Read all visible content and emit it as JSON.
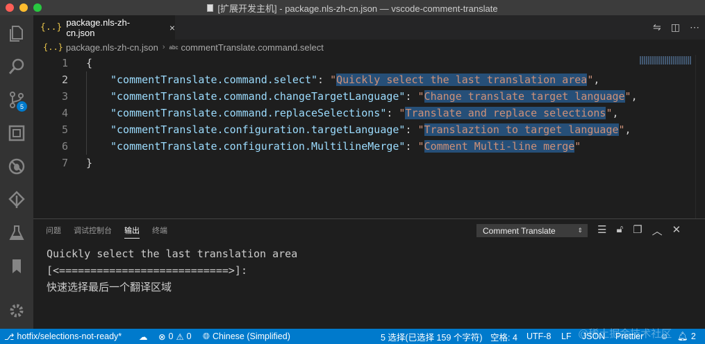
{
  "window": {
    "title": "[扩展开发主机] - package.nls-zh-cn.json — vscode-comment-translate"
  },
  "activity_bar": {
    "scm_badge": "5",
    "items": [
      "explorer",
      "search",
      "source-control",
      "extensions",
      "debug",
      "git-lens",
      "test",
      "bookmarks",
      "settings"
    ]
  },
  "tab": {
    "icon": "{..}",
    "label": "package.nls-zh-cn.json",
    "close": "×"
  },
  "breadcrumb": {
    "file_icon": "{..}",
    "file": "package.nls-zh-cn.json",
    "sep": "›",
    "abc": "abc",
    "symbol": "commentTranslate.command.select"
  },
  "editor": {
    "lines": [
      {
        "num": "1",
        "open": "{"
      },
      {
        "num": "2",
        "key": "\"commentTranslate.command.select\"",
        "value": "\"Quickly select the last translation area\"",
        "sel": "Quickly select the last translation area",
        "comma": ","
      },
      {
        "num": "3",
        "key": "\"commentTranslate.command.changeTargetLanguage\"",
        "value": "\"Change translate target language\"",
        "sel": "Change translate target language",
        "comma": ","
      },
      {
        "num": "4",
        "key": "\"commentTranslate.command.replaceSelections\"",
        "value": "\"Translate and replace selections\"",
        "sel": "Translate and replace selections",
        "comma": ","
      },
      {
        "num": "5",
        "key": "\"commentTranslate.configuration.targetLanguage\"",
        "value": "\"Translaztion to target language\"",
        "sel": "Translaztion to target language",
        "comma": ","
      },
      {
        "num": "6",
        "key": "\"commentTranslate.configuration.MultilineMerge\"",
        "value": "\"Comment Multi-line merge\"",
        "sel": "Comment Multi-line merge",
        "comma": ""
      },
      {
        "num": "7",
        "close": "}"
      }
    ]
  },
  "panel": {
    "tabs": [
      "问题",
      "调试控制台",
      "输出",
      "终端"
    ],
    "active_tab": "输出",
    "channel": "Comment Translate",
    "output": [
      "Quickly select the last translation area",
      "[<===========================>]:",
      "快速选择最后一个翻译区域"
    ]
  },
  "status_bar": {
    "branch": "hotfix/selections-not-ready*",
    "errors": "0",
    "warnings": "0",
    "language_target": "Chinese (Simplified)",
    "selection": "5 选择(已选择 159 个字符)",
    "indent": "空格: 4",
    "encoding": "UTF-8",
    "eol": "LF",
    "language": "JSON",
    "formatter": "Prettier",
    "notifications": "2"
  },
  "watermark": "@稀土掘金技术社区",
  "colors": {
    "accent": "#007acc",
    "selection": "#264f78",
    "key": "#9cdcfe",
    "string": "#ce9178"
  }
}
